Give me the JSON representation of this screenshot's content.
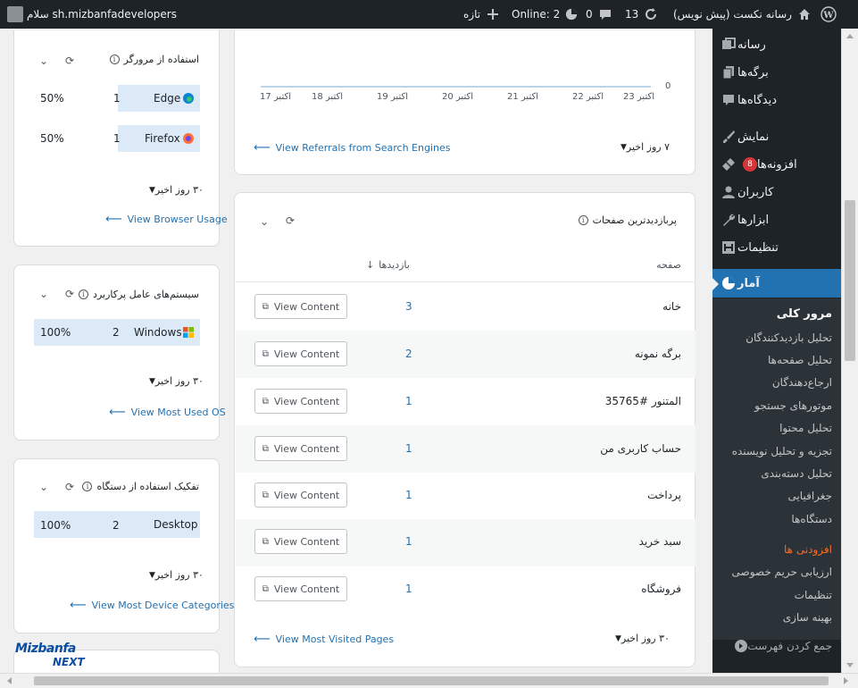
{
  "adminbar": {
    "site_name": "رسانه نکست (پیش نویس)",
    "updates": "13",
    "comments": "0",
    "online": "Online: 2",
    "new": "تازه",
    "greeting": "سلام sh.mizbanfadevelopers"
  },
  "sidebar": {
    "items": [
      {
        "label": "رسانه",
        "icon": "media-icon"
      },
      {
        "label": "برگه‌ها",
        "icon": "pages-icon"
      },
      {
        "label": "دیدگاه‌ها",
        "icon": "comments-icon"
      },
      {
        "label": "نمایش",
        "icon": "appearance-icon"
      },
      {
        "label": "افزونه‌ها",
        "icon": "plugins-icon",
        "badge": "8"
      },
      {
        "label": "کاربران",
        "icon": "users-icon"
      },
      {
        "label": "ابزارها",
        "icon": "tools-icon"
      },
      {
        "label": "تنظیمات",
        "icon": "settings-icon"
      },
      {
        "label": "آمار",
        "icon": "statistics-icon"
      }
    ],
    "submenu": [
      "مرور کلی",
      "تحلیل بازدیدکنندگان",
      "تحلیل صفحه‌ها",
      "ارجاع‌دهندگان",
      "موتورهای جستجو",
      "تحلیل محتوا",
      "تجزیه و تحلیل نویسنده",
      "تحلیل دسته‌بندی",
      "جغرافیایی",
      "دستگاه‌ها",
      "افزودنی ها",
      "ارزیابی حریم خصوصی",
      "تنظیمات",
      "بهینه سازی"
    ],
    "collapse": "جمع کردن فهرست"
  },
  "browser_card": {
    "title": "استفاده از مرورگر",
    "rows": [
      {
        "name": "Edge",
        "count": "1",
        "percent": "50%"
      },
      {
        "name": "Firefox",
        "count": "1",
        "percent": "50%"
      }
    ],
    "period": "۳۰ روز اخیر",
    "link": "View Browser Usage"
  },
  "os_card": {
    "title": "سیستم‌های عامل پرکاربرد",
    "rows": [
      {
        "name": "Windows",
        "count": "2",
        "percent": "100%"
      }
    ],
    "period": "۳۰ روز اخیر",
    "link": "View Most Used OS"
  },
  "device_card": {
    "title": "تفکیک استفاده از دستگاه",
    "rows": [
      {
        "name": "Desktop",
        "count": "2",
        "percent": "100%"
      }
    ],
    "period": "۳۰ روز اخیر",
    "link": "View Most Device Categories"
  },
  "referrals_card": {
    "y_zero": "0",
    "x_ticks": [
      "اکتبر 17",
      "اکتبر 18",
      "اکتبر 19",
      "اکتبر 20",
      "اکتبر 21",
      "اکتبر 22",
      "اکتبر 23"
    ],
    "period": "۷ روز اخیر",
    "link": "View Referrals from Search Engines"
  },
  "pages_card": {
    "title": "پربازدیدترین صفحات",
    "col_page": "صفحه",
    "col_views": "بازدیدها",
    "button_label": "View Content",
    "rows": [
      {
        "page": "خانه",
        "views": "3"
      },
      {
        "page": "برگه نمونه",
        "views": "2"
      },
      {
        "page": "المتنور #35765",
        "views": "1"
      },
      {
        "page": "حساب کاربری من",
        "views": "1"
      },
      {
        "page": "پرداخت",
        "views": "1"
      },
      {
        "page": "سبد خرید",
        "views": "1"
      },
      {
        "page": "فروشگاه",
        "views": "1"
      }
    ],
    "period": "۳۰ روز اخیر",
    "link": "View Most Visited Pages"
  },
  "logo": {
    "line1": "Mizbanfa",
    "line2": "NEXT"
  },
  "colors": {
    "admin_dark": "#1d2327",
    "accent": "#2271b1",
    "highlight": "#dce9f6",
    "badge": "#d63638"
  }
}
